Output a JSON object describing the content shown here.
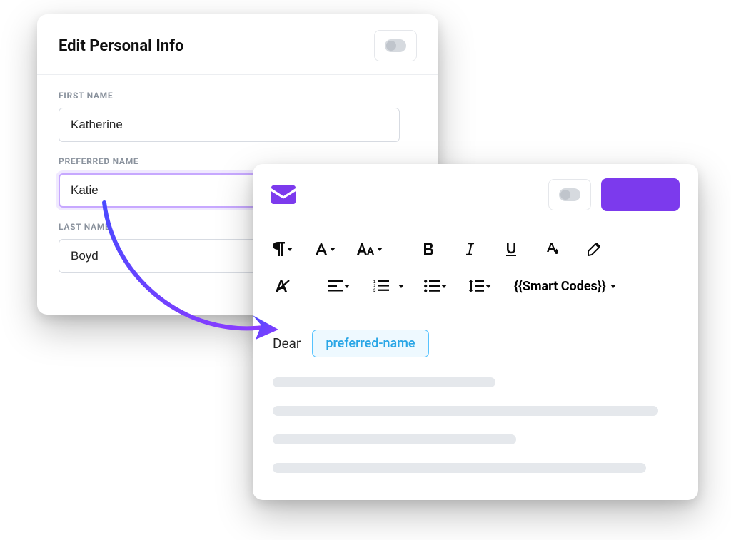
{
  "form": {
    "title": "Edit Personal Info",
    "fields": {
      "first_name": {
        "label": "FIRST NAME",
        "value": "Katherine"
      },
      "preferred_name": {
        "label": "PREFERRED NAME",
        "value": "Katie"
      },
      "last_name": {
        "label": "LAST NAME",
        "value": "Boyd"
      }
    }
  },
  "editor": {
    "greeting": "Dear",
    "smart_code_chip": "preferred-name",
    "smart_codes_button": "{{Smart Codes}}"
  },
  "colors": {
    "accent": "#7c3aed",
    "chip_border": "#56c3ff",
    "chip_text": "#2aa6e6"
  }
}
